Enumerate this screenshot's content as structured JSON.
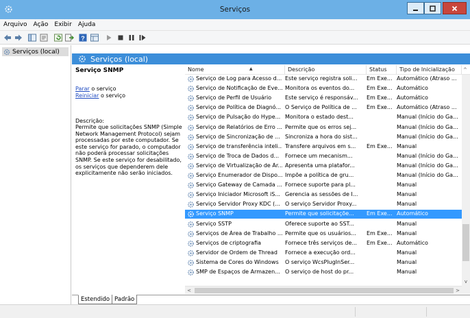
{
  "window": {
    "title": "Serviços"
  },
  "menu": [
    "Arquivo",
    "Ação",
    "Exibir",
    "Ajuda"
  ],
  "toolbar_icons": [
    "back-arrow-icon",
    "forward-arrow-icon",
    "show-hide-tree-icon",
    "properties-icon",
    "refresh-icon",
    "export-list-icon",
    "help-icon",
    "view-icon",
    "start-service-icon",
    "stop-service-icon",
    "pause-service-icon",
    "restart-service-icon"
  ],
  "tree": {
    "item": "Serviços (local)"
  },
  "header": {
    "title": "Serviços (local)"
  },
  "details": {
    "service_name": "Serviço SNMP",
    "stop_link": "Parar",
    "stop_suffix": " o serviço",
    "restart_link": "Reiniciar",
    "restart_suffix": " o serviço",
    "desc_label": "Descrição:",
    "desc_text": "Permite que solicitações SNMP (Simple Network Management Protocol) sejam processadas por este computador. Se este serviço for parado, o computador não poderá processar solicitações SNMP. Se este serviço for desabilitado, os serviços que dependerem dele explicitamente não serão iniciados."
  },
  "columns": {
    "name": "Nome",
    "desc": "Descrição",
    "status": "Status",
    "type": "Tipo de Inicialização"
  },
  "rows": [
    {
      "name": "Serviço de Log para Acesso d...",
      "desc": "Este serviço registra soli...",
      "status": "Em Exe...",
      "type": "Automático (Atraso ..."
    },
    {
      "name": "Serviço de Notificação de Eve...",
      "desc": "Monitora os eventos do...",
      "status": "Em Exe...",
      "type": "Automático"
    },
    {
      "name": "Serviço de Perfil de Usuário",
      "desc": "Este serviço é responsáv...",
      "status": "Em Exe...",
      "type": "Automático"
    },
    {
      "name": "Serviço de Política de Diagnó...",
      "desc": "O Serviço de Política de ...",
      "status": "Em Exe...",
      "type": "Automático (Atraso ..."
    },
    {
      "name": "Serviço de Pulsação do Hype...",
      "desc": "Monitora o estado dest...",
      "status": "",
      "type": "Manual (Início do Ga..."
    },
    {
      "name": "Serviço de Relatórios de Erro ...",
      "desc": "Permite que os erros sej...",
      "status": "",
      "type": "Manual (Início do Ga..."
    },
    {
      "name": "Serviço de Sincronização de ...",
      "desc": "Sincroniza a hora do sist...",
      "status": "",
      "type": "Manual (Início do Ga..."
    },
    {
      "name": "Serviço de transferência inteli...",
      "desc": "Transfere arquivos em s...",
      "status": "Em Exe...",
      "type": "Manual"
    },
    {
      "name": "Serviço de Troca de Dados d...",
      "desc": "Fornece um mecanism...",
      "status": "",
      "type": "Manual (Início do Ga..."
    },
    {
      "name": "Serviço de Virtualização de Ár...",
      "desc": "Apresenta uma platafor...",
      "status": "",
      "type": "Manual (Início do Ga..."
    },
    {
      "name": "Serviço Enumerador de Dispo...",
      "desc": "Impõe a política de gru...",
      "status": "",
      "type": "Manual (Início do Ga..."
    },
    {
      "name": "Serviço Gateway de Camada ...",
      "desc": "Fornece suporte para pl...",
      "status": "",
      "type": "Manual"
    },
    {
      "name": "Serviço Iniciador Microsoft iS...",
      "desc": "Gerencia as sessões de I...",
      "status": "",
      "type": "Manual"
    },
    {
      "name": "Serviço Servidor Proxy KDC (...",
      "desc": "O serviço Servidor Proxy...",
      "status": "",
      "type": "Manual"
    },
    {
      "name": "Serviço SNMP",
      "desc": "Permite que solicitaçõe...",
      "status": "Em Exe...",
      "type": "Automático",
      "selected": true
    },
    {
      "name": "Serviço SSTP",
      "desc": "Oferece suporte ao SST...",
      "status": "",
      "type": "Manual"
    },
    {
      "name": "Serviços de Área de Trabalho ...",
      "desc": "Permite que os usuários...",
      "status": "Em Exe...",
      "type": "Manual"
    },
    {
      "name": "Serviços de criptografia",
      "desc": "Fornece três serviços de...",
      "status": "Em Exe...",
      "type": "Automático"
    },
    {
      "name": "Servidor de Ordem de Thread",
      "desc": "Fornece a execução ord...",
      "status": "",
      "type": "Manual"
    },
    {
      "name": "Sistema de Cores do Windows",
      "desc": "O serviço WcsPlugInSer...",
      "status": "",
      "type": "Manual"
    },
    {
      "name": "SMP de Espaços de Armazen...",
      "desc": "O serviço de host do pr...",
      "status": "",
      "type": "Manual"
    }
  ],
  "tabs": [
    "Estendido",
    "Padrão"
  ],
  "colors": {
    "titlebar": "#6cb0e6",
    "header": "#3c8ed9",
    "selection": "#3399ff",
    "close": "#c8463c"
  }
}
